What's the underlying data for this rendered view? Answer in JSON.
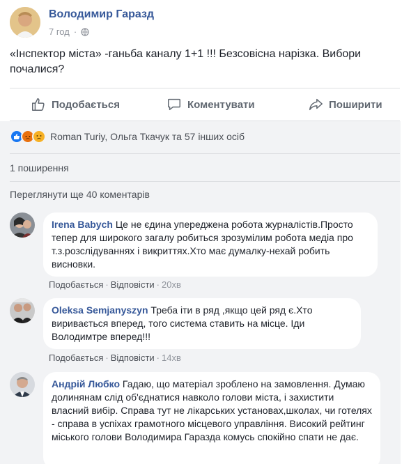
{
  "post": {
    "author": "Володимир Гаразд",
    "time": "7 год",
    "separator": "·",
    "text": "«Інспектор міста» -ганьба каналу 1+1 !!! Безсовісна нарізка. Вибори почалися?"
  },
  "actions": {
    "like": "Подобається",
    "comment": "Коментувати",
    "share": "Поширити"
  },
  "reactions": {
    "names": "Roman Turiy, Ольга Ткачук та 57 інших осіб"
  },
  "shares": "1 поширення",
  "more_comments": "Переглянути ще 40 коментарів",
  "comments": [
    {
      "name": "Irena Babych",
      "text": "Це не єдина упереджена робота журналістів.Просто тепер для широкого загалу робиться зрозумілим робота медіа про т.з.розслідуваннях і викриттях.Хто має думалку-нехай робить висновки.",
      "like": "Подобається",
      "reply": "Відповісти",
      "time": "20хв"
    },
    {
      "name": "Oleksa Semjanyszyn",
      "text": "Треба іти в ряд ,якщо цей ряд є.Хто виривається вперед, того система ставить на місце. Іди Володимтре вперед!!!",
      "like": "Подобається",
      "reply": "Відповісти",
      "time": "14хв"
    },
    {
      "name": "Андрій Любко",
      "text": "Гадаю, що матеріал зроблено на замовлення. Думаю долинянам слід об'єднатися навколо голови міста, і захистити власний вибір. Справа тут не лікарських установах,школах, чи готелях - справа в успіхах грамотного місцевого управління. Високий рейтинг міського голови Володимира Гаразда комусь спокійно спати не дає."
    }
  ],
  "colors": {
    "link": "#365899",
    "muted": "#90949c",
    "background": "#f2f3f5"
  }
}
